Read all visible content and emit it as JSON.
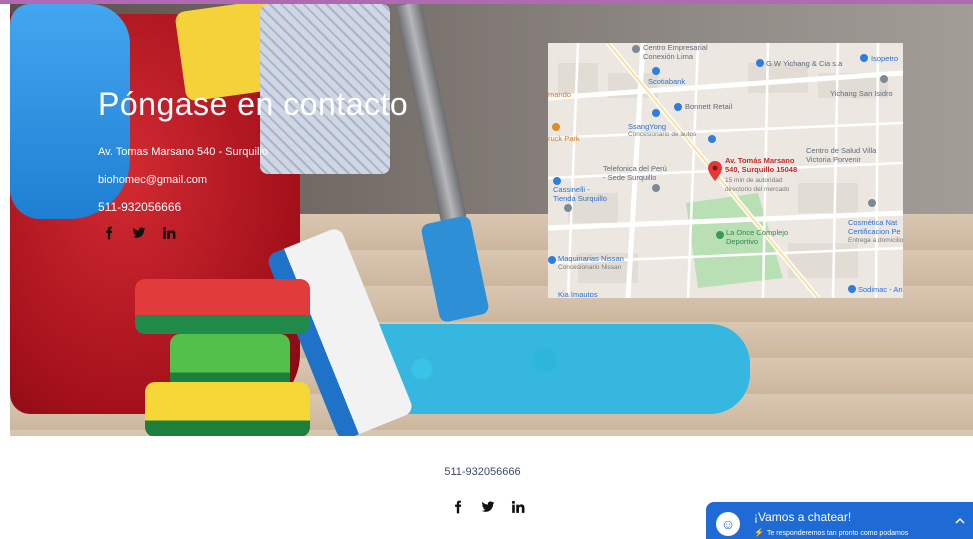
{
  "contact": {
    "title": "Póngase en contacto",
    "address": "Av. Tomas Marsano 540 - Surquillo",
    "email": "biohomec@gmail.com",
    "phone": "511-932056666"
  },
  "social_icons": [
    "facebook-icon",
    "twitter-icon",
    "linkedin-icon"
  ],
  "map": {
    "labels": {
      "centro_empresarial": "Centro Empresarial\nConexión Lima",
      "scotiabank": "Scotiabank",
      "gw_yichang": "G.W Yichang & Cia s.a",
      "isopetro": "Isopetro",
      "yichang_san_isidro": "Yichang San Isidro",
      "bonnett": "Bonnett Retail",
      "mando": "mando",
      "ssangyong": "SsangYong",
      "ssangyong_sub": "Concesionario de autos",
      "truck_park": "ruck Park",
      "centro_salud": "Centro de Salud Villa\nVictoria Porvenir",
      "telefonica": "Telefonica del Perú\n- Sede Surquillo",
      "marker_address": "Av. Tomás Marsano\n540, Surquillo 15048",
      "marker_sub": "15 min de autoridad\ndirectorio del mercado",
      "cassinelli": "Cassinelli -\nTienda Surquillo",
      "cosmetica": "Cosmética Nat\nCertificacion Pe",
      "cosmetica_sub": "Entrega a domicilio",
      "la_once": "La Once Complejo\nDeportivo",
      "maquinarias": "Maquinarias Nissan",
      "maquinarias_sub": "Concesionario Nissan",
      "sodimac": "Sodimac - Ang",
      "kia": "Kia Imautos"
    }
  },
  "footer": {
    "phone": "511-932056666"
  },
  "chat": {
    "title": "¡Vamos a chatear!",
    "subtitle": "Te responderemos tan pronto como podamos"
  },
  "colors": {
    "top_bar": "#b06ab3",
    "chat_bg": "#1f6bd6",
    "footer_text": "#3d4a6b"
  }
}
